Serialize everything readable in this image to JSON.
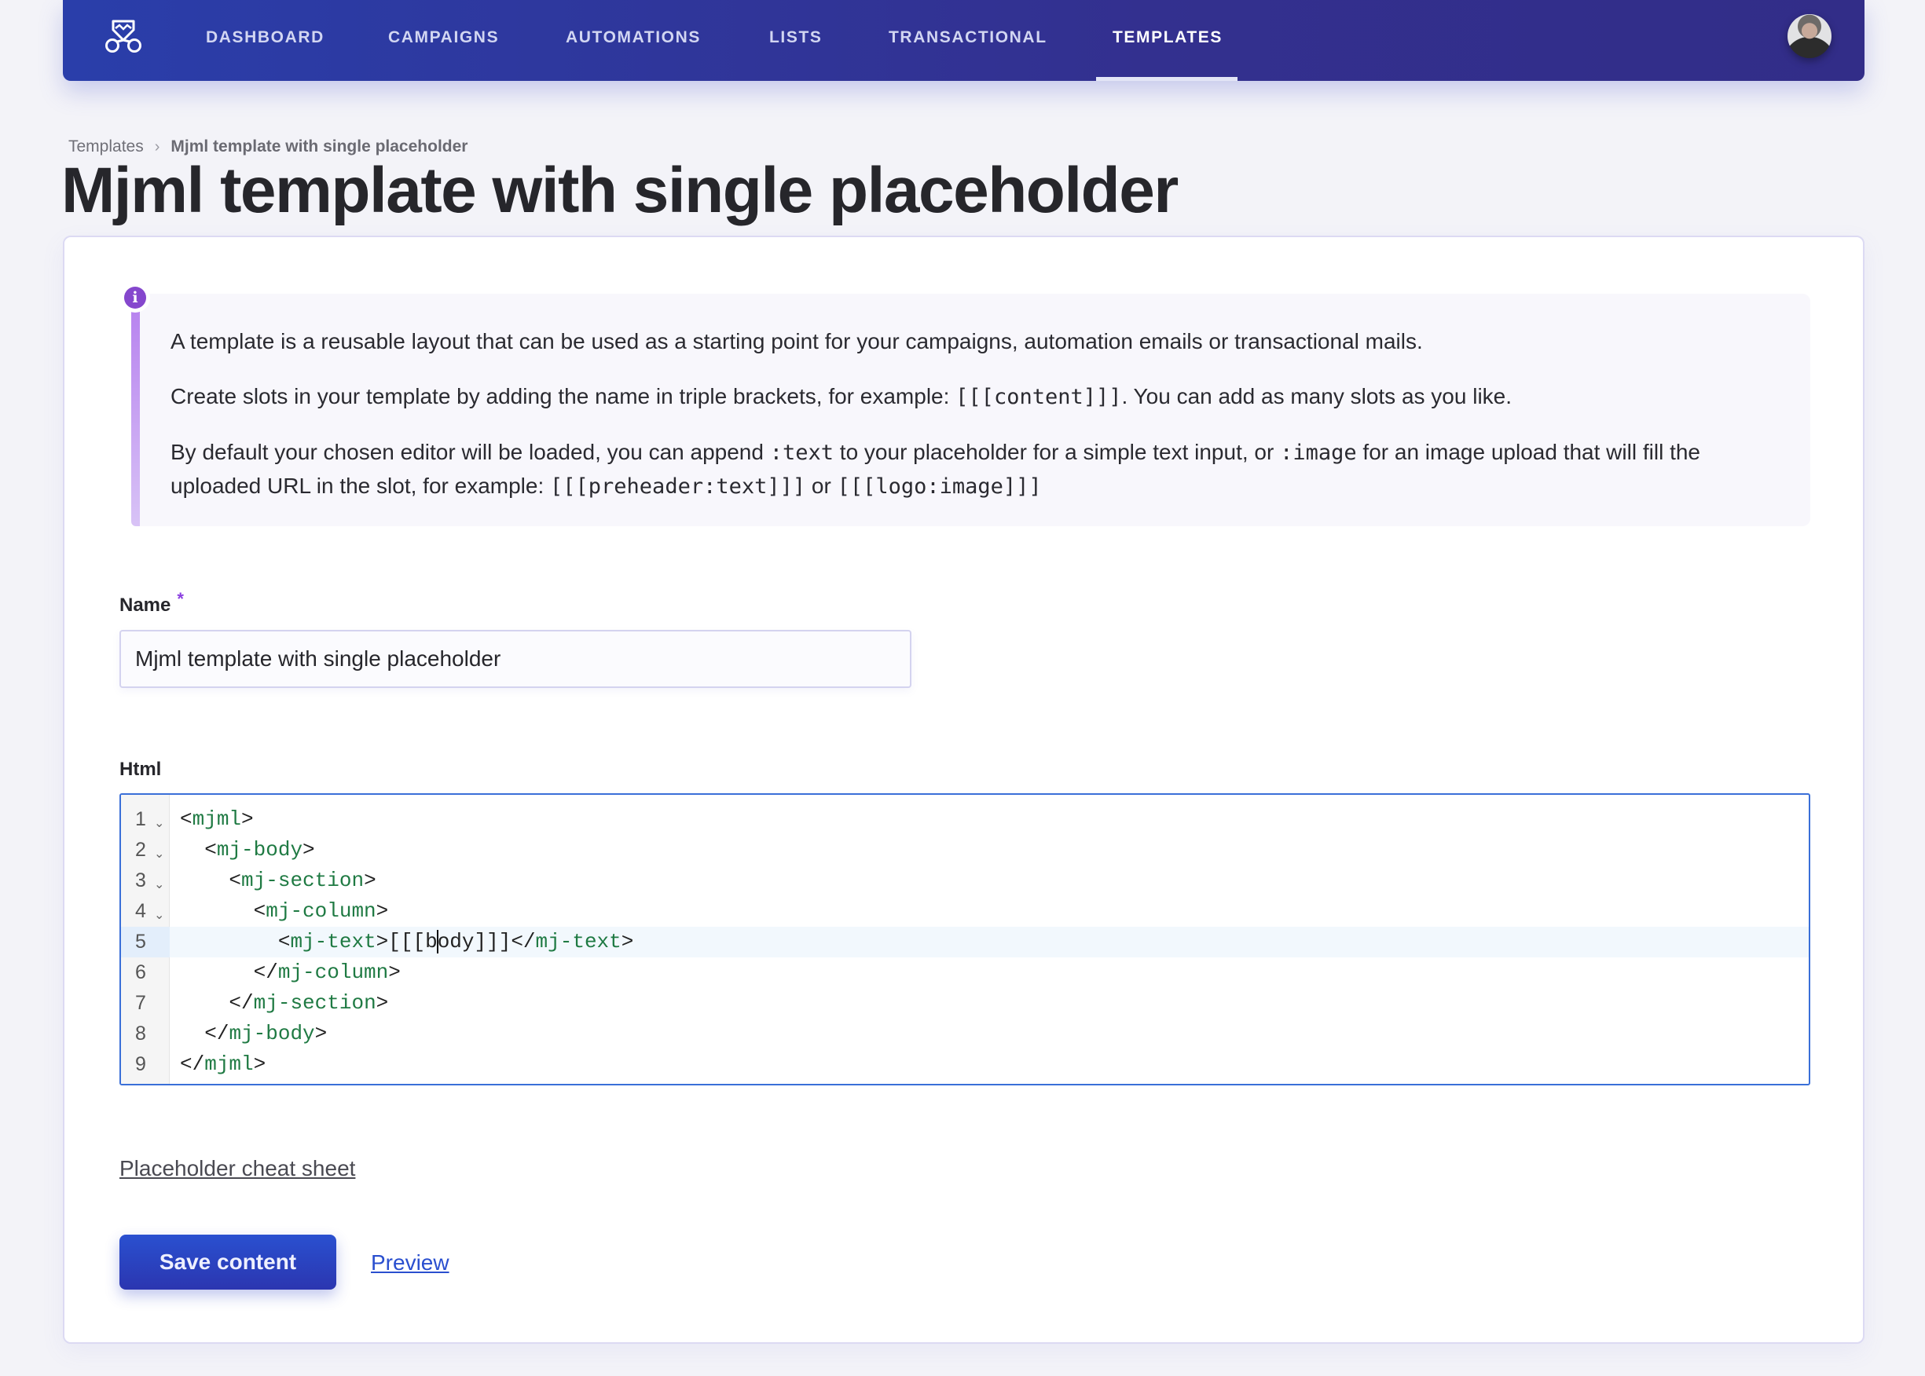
{
  "nav": {
    "logo": "mailcoach-logo-icon",
    "items": [
      {
        "label": "DASHBOARD",
        "active": false
      },
      {
        "label": "CAMPAIGNS",
        "active": false
      },
      {
        "label": "AUTOMATIONS",
        "active": false
      },
      {
        "label": "LISTS",
        "active": false
      },
      {
        "label": "TRANSACTIONAL",
        "active": false
      },
      {
        "label": "TEMPLATES",
        "active": true
      }
    ],
    "avatar": "user-avatar"
  },
  "breadcrumb": {
    "parent": "Templates",
    "separator_icon": "chevron-right-icon",
    "current": "Mjml template with single placeholder"
  },
  "page_title": "Mjml template with single placeholder",
  "info": {
    "icon": "info-icon",
    "p1": "A template is a reusable layout that can be used as a starting point for your campaigns, automation emails or transactional mails.",
    "p2_before": "Create slots in your template by adding the name in triple brackets, for example: ",
    "p2_code": "[[[content]]]",
    "p2_after": ". You can add as many slots as you like.",
    "p3_a": "By default your chosen editor will be loaded, you can append ",
    "p3_code1": ":text",
    "p3_b": " to your placeholder for a simple text input, or ",
    "p3_code2": ":image",
    "p3_c": " for an image upload that will fill the uploaded URL in the slot, for example: ",
    "p3_code3": "[[[preheader:text]]]",
    "p3_d": " or ",
    "p3_code4": "[[[logo:image]]]"
  },
  "form": {
    "name_label": "Name",
    "required_mark": "*",
    "name_value": "Mjml template with single placeholder",
    "html_label": "Html",
    "editor": {
      "active_line": 5,
      "lines": [
        {
          "n": "1",
          "indent": "",
          "open": "<",
          "tag": "mjml",
          "close": ">",
          "content": "",
          "end_open": "",
          "end_tag": "",
          "end_close": "",
          "fold": true
        },
        {
          "n": "2",
          "indent": "  ",
          "open": "<",
          "tag": "mj-body",
          "close": ">",
          "content": "",
          "end_open": "",
          "end_tag": "",
          "end_close": "",
          "fold": true
        },
        {
          "n": "3",
          "indent": "    ",
          "open": "<",
          "tag": "mj-section",
          "close": ">",
          "content": "",
          "end_open": "",
          "end_tag": "",
          "end_close": "",
          "fold": true
        },
        {
          "n": "4",
          "indent": "      ",
          "open": "<",
          "tag": "mj-column",
          "close": ">",
          "content": "",
          "end_open": "",
          "end_tag": "",
          "end_close": "",
          "fold": true
        },
        {
          "n": "5",
          "indent": "        ",
          "open": "<",
          "tag": "mj-text",
          "close": ">",
          "content": "[[[body]]]",
          "end_open": "</",
          "end_tag": "mj-text",
          "end_close": ">",
          "fold": false
        },
        {
          "n": "6",
          "indent": "      ",
          "open": "</",
          "tag": "mj-column",
          "close": ">",
          "content": "",
          "end_open": "",
          "end_tag": "",
          "end_close": "",
          "fold": false
        },
        {
          "n": "7",
          "indent": "    ",
          "open": "</",
          "tag": "mj-section",
          "close": ">",
          "content": "",
          "end_open": "",
          "end_tag": "",
          "end_close": "",
          "fold": false
        },
        {
          "n": "8",
          "indent": "  ",
          "open": "</",
          "tag": "mj-body",
          "close": ">",
          "content": "",
          "end_open": "",
          "end_tag": "",
          "end_close": "",
          "fold": false
        },
        {
          "n": "9",
          "indent": "",
          "open": "</",
          "tag": "mjml",
          "close": ">",
          "content": "",
          "end_open": "",
          "end_tag": "",
          "end_close": "",
          "fold": false
        }
      ]
    },
    "cheat_sheet_link": "Placeholder cheat sheet",
    "save_label": "Save content",
    "preview_label": "Preview"
  },
  "colors": {
    "nav_bg": "#2a3eaa",
    "accent": "#2a4fcf",
    "info_accent": "#8547cd",
    "code_tag": "#1f7a43"
  }
}
